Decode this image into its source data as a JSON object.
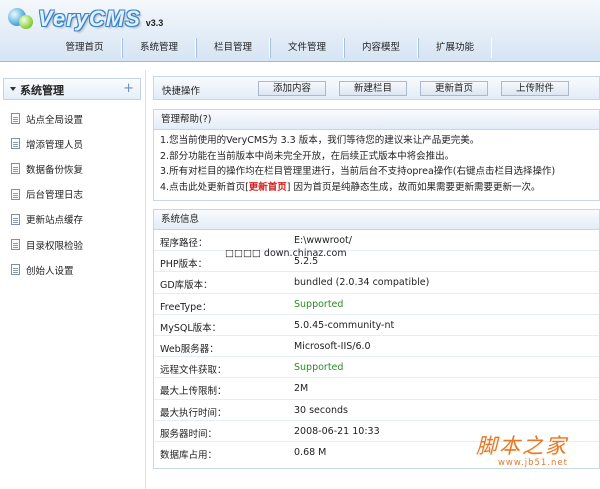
{
  "header": {
    "logo_text": "VeryCMS",
    "version": "v3.3",
    "nav": [
      "管理首页",
      "系统管理",
      "栏目管理",
      "文件管理",
      "内容模型",
      "扩展功能"
    ]
  },
  "sidebar": {
    "title": "系统管理",
    "plus": "+",
    "items": [
      "站点全局设置",
      "增添管理人员",
      "数据备份恢复",
      "后台管理日志",
      "更新站点缓存",
      "目录权限检验",
      "创始人设置"
    ]
  },
  "quick": {
    "label": "快捷操作",
    "buttons": [
      "添加内容",
      "新建栏目",
      "更新首页",
      "上传附件"
    ]
  },
  "help": {
    "title": "管理帮助(?)",
    "lines": [
      "1.您当前使用的VeryCMS为 3.3 版本，我们等待您的建议来让产品更完美。",
      "2.部分功能在当前版本中尚未完全开放，在后续正式版本中将会推出。",
      "3.所有对栏目的操作均在栏目管理里进行，当前后台不支持oprea操作(右键点击栏目选择操作)"
    ],
    "line4_pre": "4.点击此处更新首页[",
    "line4_link": "更新首页",
    "line4_post": "] 因为首页是纯静态生成，故而如果需要更新需要更新一次。"
  },
  "sysinfo": {
    "title": "系统信息",
    "rows": [
      {
        "key": "程序路径：",
        "value": "E:\\wwwroot/"
      },
      {
        "key": "PHP版本：",
        "value": "5.2.5"
      },
      {
        "key": "GD库版本：",
        "value": "bundled (2.0.34 compatible)"
      },
      {
        "key": "FreeType：",
        "value": "Supported"
      },
      {
        "key": "MySQL版本：",
        "value": "5.0.45-community-nt"
      },
      {
        "key": "Web服务器：",
        "value": "Microsoft-IIS/6.0"
      },
      {
        "key": "远程文件获取：",
        "value": "Supported"
      },
      {
        "key": "最大上传限制：",
        "value": "2M"
      },
      {
        "key": "最大执行时间：",
        "value": "30 seconds"
      },
      {
        "key": "服务器时间：",
        "value": "2008-06-21 10:33"
      },
      {
        "key": "数据库占用：",
        "value": "0.68 M"
      }
    ],
    "overlay_text": "□□□□ down.chinaz.com"
  },
  "watermark": {
    "cn": "脚本之家",
    "url": "www.jb51.net"
  },
  "colors": {
    "supported": "#2b8a25",
    "link_red": "#d42121",
    "watermark": "#e37a2a"
  }
}
